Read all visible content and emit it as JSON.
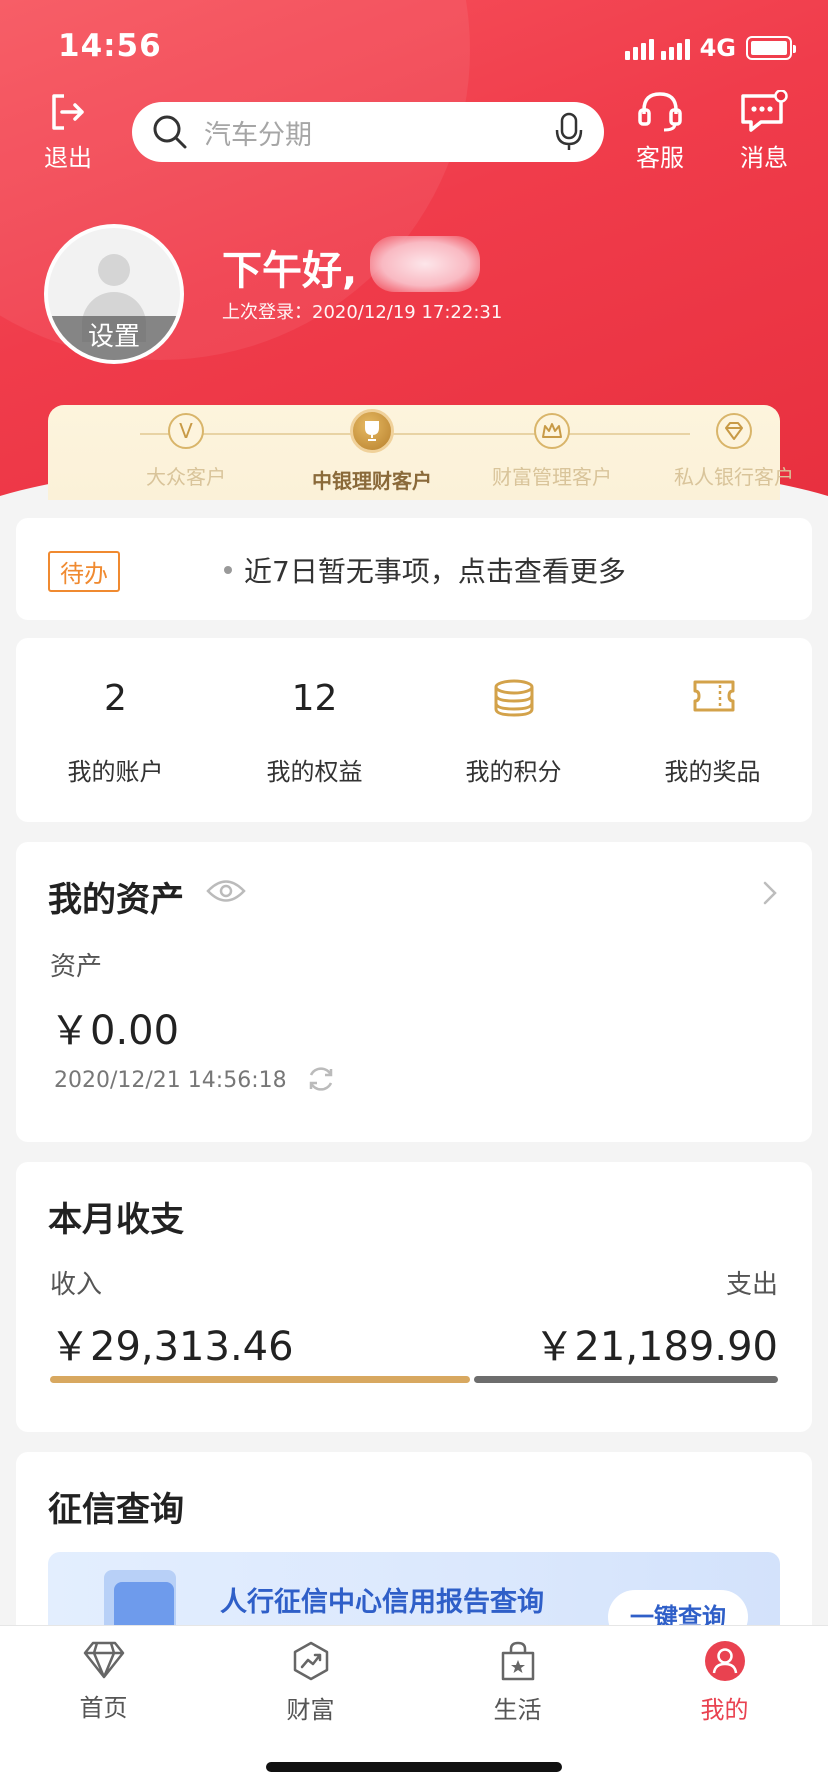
{
  "status_bar": {
    "time": "14:56",
    "network": "4G"
  },
  "header": {
    "logout_label": "退出",
    "search_placeholder": "汽车分期",
    "service_label": "客服",
    "message_label": "消息"
  },
  "profile": {
    "avatar_setting_label": "设置",
    "greeting": "下午好,",
    "last_login": "上次登录：2020/12/19 17:22:31"
  },
  "levels": [
    {
      "label": "大众客户",
      "icon": "v-medal-icon"
    },
    {
      "label": "中银理财客户",
      "icon": "trophy-medal-icon",
      "active": true
    },
    {
      "label": "财富管理客户",
      "icon": "crown-medal-icon"
    },
    {
      "label": "私人银行客户",
      "icon": "diamond-medal-icon"
    }
  ],
  "todo": {
    "tag": "待办",
    "text": "近7日暂无事项，点击查看更多"
  },
  "stats": [
    {
      "value": "2",
      "label": "我的账户"
    },
    {
      "value": "12",
      "label": "我的权益"
    },
    {
      "icon": "coins-icon",
      "label": "我的积分"
    },
    {
      "icon": "ticket-icon",
      "label": "我的奖品"
    }
  ],
  "assets": {
    "title": "我的资产",
    "subtitle": "资产",
    "amount": "￥0.00",
    "updated": "2020/12/21 14:56:18"
  },
  "monthly": {
    "title": "本月收支",
    "income_label": "收入",
    "income_amount": "￥29,313.46",
    "expense_label": "支出",
    "expense_amount": "￥21,189.90",
    "income_share": 0.58
  },
  "credit": {
    "title": "征信查询",
    "banner_text": "人行征信中心信用报告查询",
    "banner_button": "一键查询"
  },
  "tabbar": [
    {
      "label": "首页",
      "icon": "diamond-icon"
    },
    {
      "label": "财富",
      "icon": "chart-trend-icon"
    },
    {
      "label": "生活",
      "icon": "shopping-bag-icon"
    },
    {
      "label": "我的",
      "icon": "user-icon",
      "active": true
    }
  ],
  "colors": {
    "brand_red": "#f03c4b",
    "gold": "#d8a860",
    "active_tab": "#e94250",
    "todo_orange": "#f08a30"
  }
}
